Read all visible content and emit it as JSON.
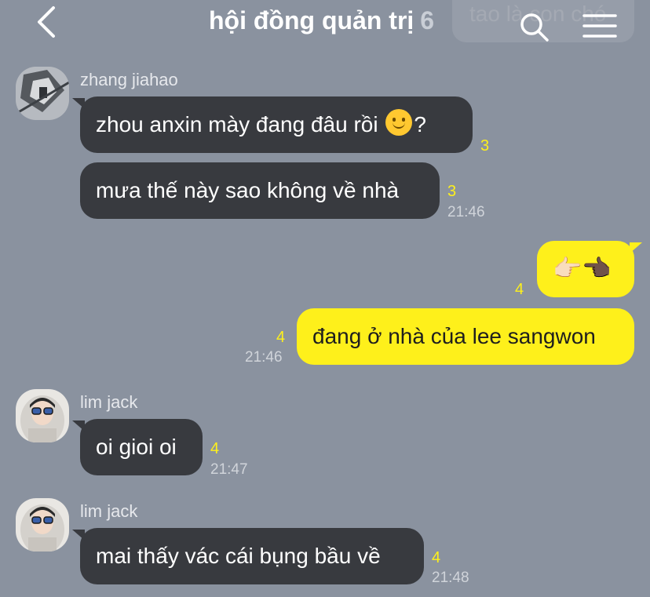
{
  "header": {
    "title": "hội đồng quản trị",
    "member_count": "6",
    "ghost_text": "tao là con chó"
  },
  "icons": {
    "back": "chevron-left-icon",
    "search": "search-icon",
    "menu": "hamburger-menu-icon",
    "smile": "smile-emoji",
    "point_right": "pointing-right-emoji",
    "point_left": "pointing-left-emoji"
  },
  "colors": {
    "background": "#8a929f",
    "incoming_bubble": "#383a3f",
    "outgoing_bubble": "#fef01b",
    "unread_count": "#fef01b"
  },
  "messages": [
    {
      "sender": "zhang jiahao",
      "text_before": "zhou anxin mày đang đâu rồi",
      "text_after": "?",
      "unread": "3"
    },
    {
      "text": "mưa thế này sao không về nhà",
      "unread": "3",
      "time": "21:46"
    },
    {
      "text": "👉🏻👈🏿",
      "unread": "4"
    },
    {
      "text": "đang ở nhà của lee sangwon",
      "unread": "4",
      "time": "21:46"
    },
    {
      "sender": "lim jack",
      "text": "oi gioi oi",
      "unread": "4",
      "time": "21:47"
    },
    {
      "sender": "lim jack",
      "text": "mai thấy vác cái bụng bầu về",
      "unread": "4",
      "time": "21:48"
    }
  ]
}
